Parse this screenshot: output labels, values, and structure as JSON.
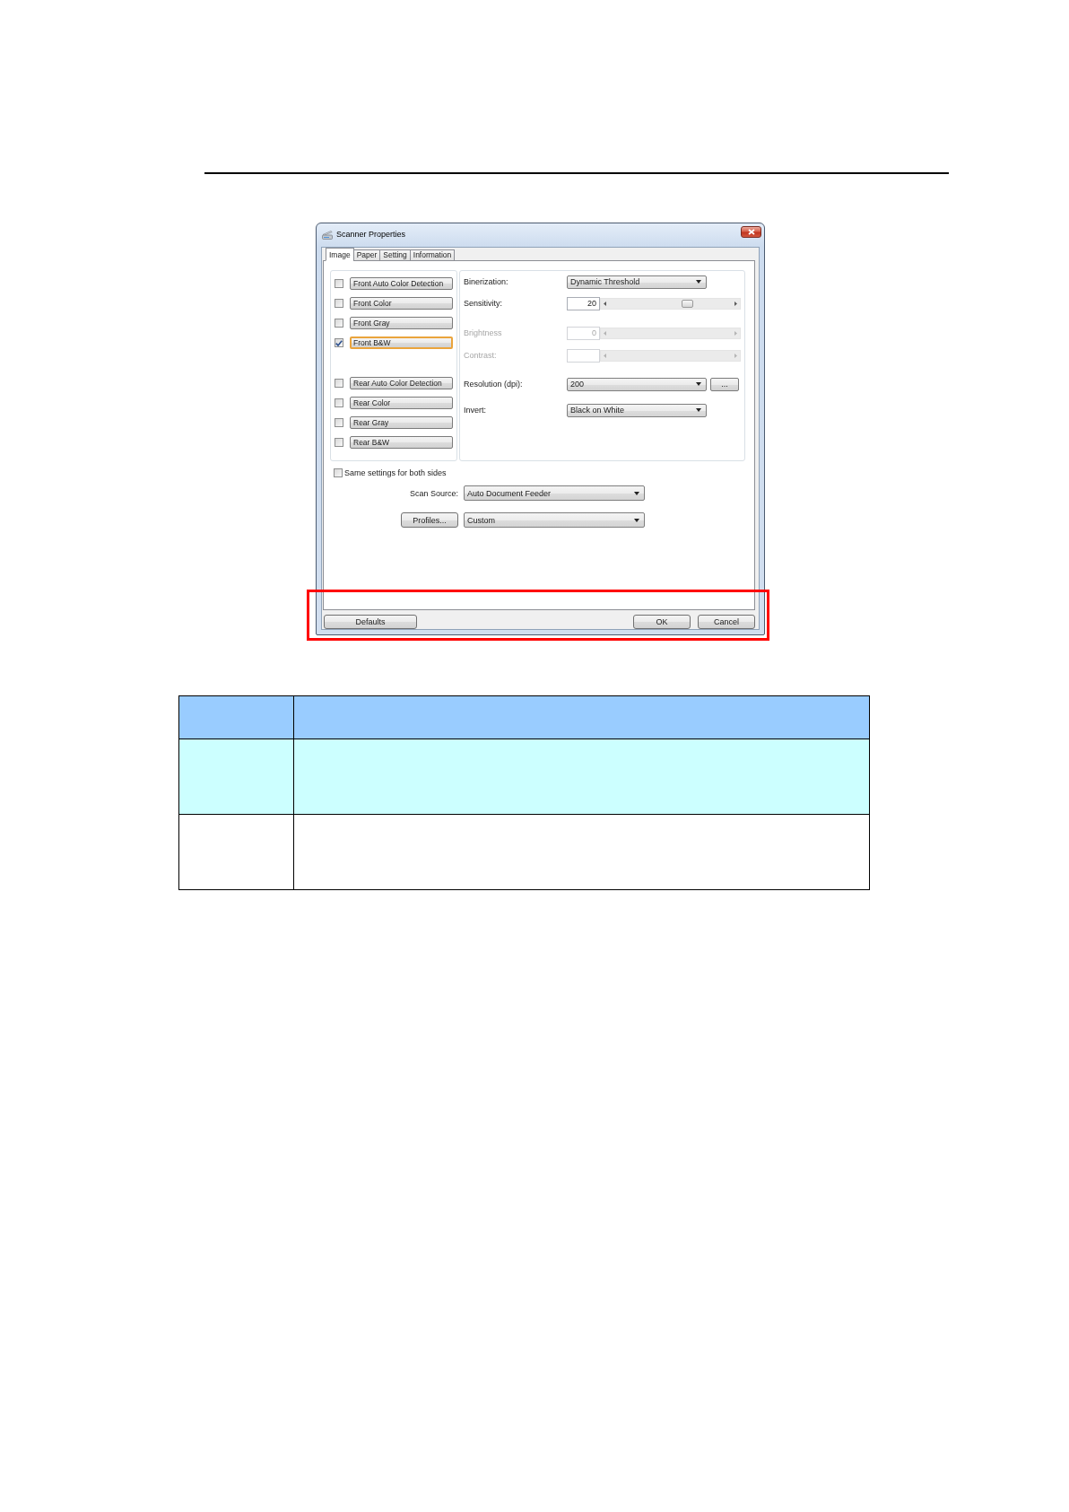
{
  "dialog": {
    "title": "Scanner Properties",
    "tabs": [
      {
        "label": "Image",
        "selected": true
      },
      {
        "label": "Paper",
        "selected": false
      },
      {
        "label": "Setting",
        "selected": false
      },
      {
        "label": "Information",
        "selected": false
      }
    ],
    "front_options": [
      {
        "label": "Front Auto Color Detection",
        "checked": false,
        "selected": false
      },
      {
        "label": "Front Color",
        "checked": false,
        "selected": false
      },
      {
        "label": "Front Gray",
        "checked": false,
        "selected": false
      },
      {
        "label": "Front B&W",
        "checked": true,
        "selected": true
      }
    ],
    "rear_options": [
      {
        "label": "Rear Auto Color Detection",
        "checked": false,
        "selected": false
      },
      {
        "label": "Rear Color",
        "checked": false,
        "selected": false
      },
      {
        "label": "Rear Gray",
        "checked": false,
        "selected": false
      },
      {
        "label": "Rear B&W",
        "checked": false,
        "selected": false
      }
    ],
    "settings": [
      {
        "kind": "dropdown",
        "label": "Binerization:",
        "value": "Dynamic Threshold",
        "disabled": false
      },
      {
        "kind": "slider",
        "label": "Sensitivity:",
        "value": "20",
        "level": 0.65,
        "disabled": false
      },
      {
        "kind": "slider",
        "label": "Brightness",
        "value": "0",
        "disabled": true
      },
      {
        "kind": "slider",
        "label": "Contrast:",
        "disabled": true
      },
      {
        "kind": "dropdown",
        "label": "Resolution (dpi):",
        "value": "200",
        "button": "...",
        "disabled": false
      },
      {
        "kind": "dropdown",
        "label": "Invert:",
        "value": "Black on White",
        "disabled": false
      }
    ],
    "same_settings": {
      "label": "Same settings for both sides",
      "checked": false
    },
    "scan_source": {
      "label": "Scan Source:",
      "value": "Auto Document Feeder"
    },
    "profile": {
      "button": "Profiles...",
      "value": "Custom"
    },
    "footer": {
      "left_buttons": [
        "Defaults"
      ],
      "right_buttons": [
        "OK",
        "Cancel"
      ]
    }
  },
  "table": {
    "rows": [
      {
        "kind": "header",
        "color": "#99ccff"
      },
      {
        "kind": "body",
        "color": "#ccffff"
      },
      {
        "kind": "body",
        "color": "#ffffff"
      }
    ]
  }
}
